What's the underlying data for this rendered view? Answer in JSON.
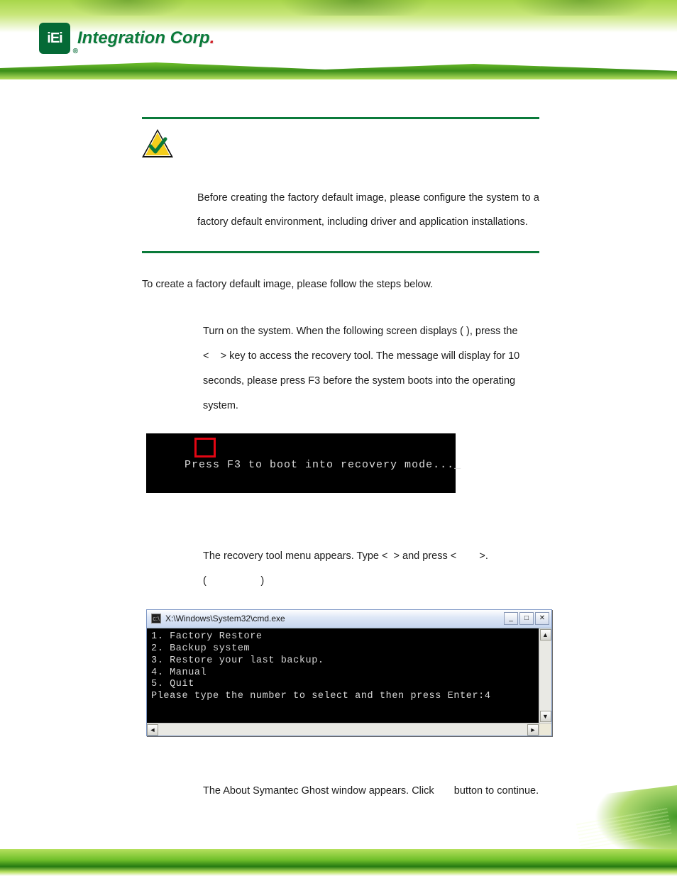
{
  "brand": {
    "mark_text": "iEi",
    "name_html": "Integration Corp"
  },
  "note": {
    "body": "Before creating the factory default image, please configure the system to a factory default environment, including driver and application installations."
  },
  "intro": "To create a factory default image, please follow the steps below.",
  "step1": "Turn on the system. When the following screen displays (                    ), press the <    > key to access the recovery tool. The message will display for 10 seconds, please press F3 before the system boots into the operating system.",
  "boot_screen": {
    "text": "Press F3 to boot into recovery mode..._"
  },
  "step2": "The recovery tool menu appears. Type <  > and press <        >. (                   )",
  "cmd_window": {
    "title": "X:\\Windows\\System32\\cmd.exe",
    "lines": [
      "1. Factory Restore",
      "2. Backup system",
      "3. Restore your last backup.",
      "4. Manual",
      "5. Quit",
      "Please type the number to select and then press Enter:4"
    ],
    "buttons": {
      "min": "_",
      "max": "□",
      "close": "✕"
    },
    "scroll": {
      "up": "▲",
      "down": "▼",
      "left": "◄",
      "right": "►"
    }
  },
  "step3": "The About Symantec Ghost window appears. Click       button to continue."
}
